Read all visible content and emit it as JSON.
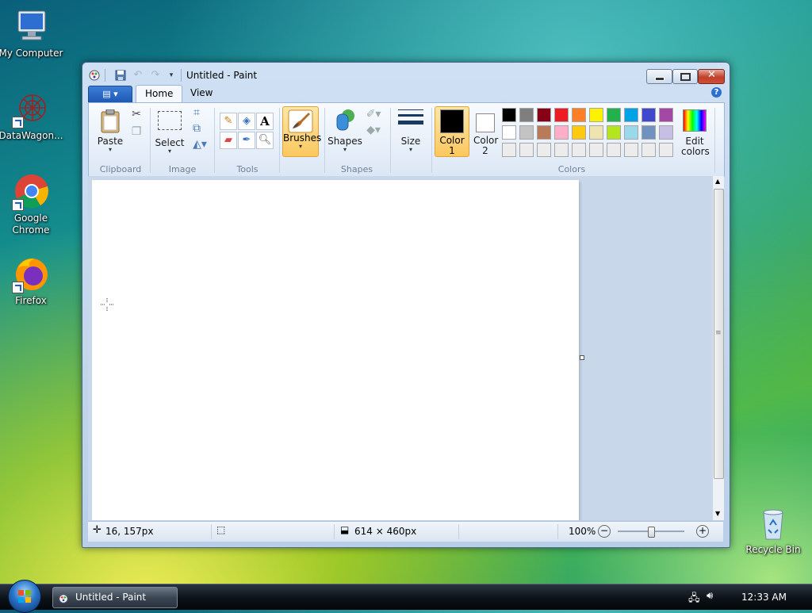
{
  "desktop": {
    "icons": [
      {
        "label": "My Computer"
      },
      {
        "label": "DataWagon..."
      },
      {
        "label": "Google Chrome"
      },
      {
        "label": "Firefox"
      },
      {
        "label": "Recycle Bin"
      }
    ]
  },
  "window": {
    "title": "Untitled - Paint",
    "tabs": [
      {
        "label": "Home"
      },
      {
        "label": "View"
      }
    ],
    "help_glyph": "?",
    "ribbon": {
      "groups": {
        "clipboard": "Clipboard",
        "image": "Image",
        "tools": "Tools",
        "shapes": "Shapes",
        "colors": "Colors"
      },
      "paste_label": "Paste",
      "select_label": "Select",
      "brushes_label": "Brushes",
      "shapes_label": "Shapes",
      "size_label": "Size",
      "color1_label": "Color 1",
      "color2_label": "Color 2",
      "edit_colors_label": "Edit colors",
      "text_tool_glyph": "A",
      "color1_value": "#000000",
      "color2_value": "#ffffff",
      "palette": [
        [
          "#000000",
          "#7f7f7f",
          "#880015",
          "#ed1c24",
          "#ff7f27",
          "#fff200",
          "#22b14c",
          "#00a2e8",
          "#3f48cc",
          "#a349a4"
        ],
        [
          "#ffffff",
          "#c3c3c3",
          "#b97a57",
          "#ffaec9",
          "#ffc90e",
          "#efe4b0",
          "#b5e61d",
          "#99d9ea",
          "#7092be",
          "#c8bfe7"
        ],
        [
          "#ececec",
          "#ececec",
          "#ececec",
          "#ececec",
          "#ececec",
          "#ececec",
          "#ececec",
          "#ececec",
          "#ececec",
          "#ececec"
        ]
      ]
    },
    "status": {
      "cursor_pos": "16, 157px",
      "canvas_size": "614 × 460px",
      "zoom": "100%",
      "zoom_level": 0.5
    }
  },
  "taskbar": {
    "task_label": "Untitled - Paint",
    "clock": "12:33 AM"
  }
}
